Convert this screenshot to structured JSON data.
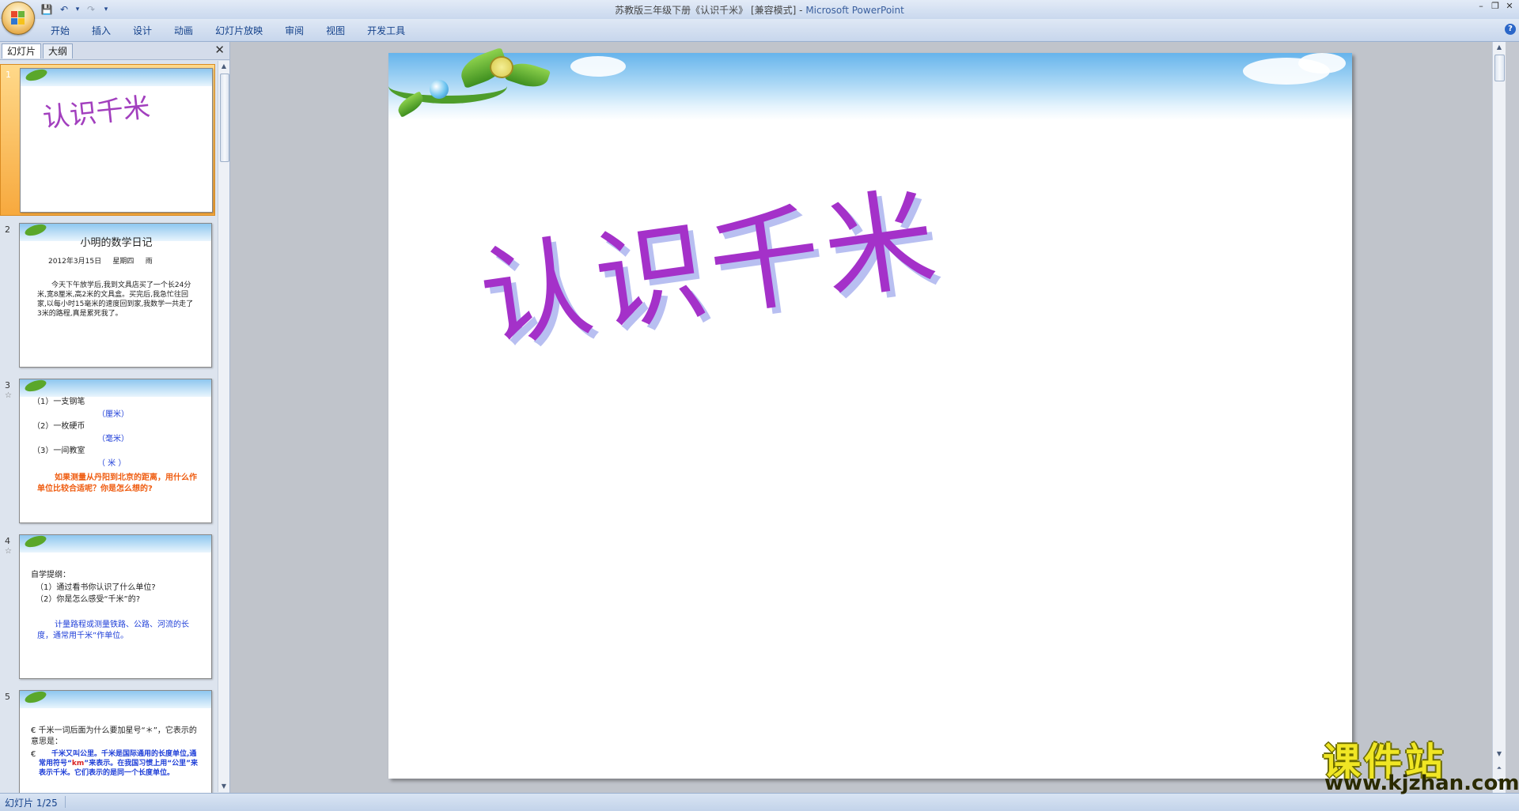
{
  "window": {
    "title": "苏教版三年级下册《认识千米》 [兼容模式] -",
    "app_name": "Microsoft PowerPoint",
    "minimize": "–",
    "restore": "❐",
    "close": "✕"
  },
  "qat": {
    "save": "💾",
    "undo": "↶",
    "undo_arrow": "▾",
    "redo": "↷",
    "customize": "▾"
  },
  "ribbon_tabs": [
    "开始",
    "插入",
    "设计",
    "动画",
    "幻灯片放映",
    "审阅",
    "视图",
    "开发工具"
  ],
  "help": "?",
  "pane_tabs": {
    "slides": "幻灯片",
    "outline": "大纲",
    "close": "✕"
  },
  "thumbnails": [
    {
      "number": "1",
      "title": "认识千米"
    },
    {
      "number": "2",
      "title": "小明的数学日记",
      "date_line": "2012年3月15日     星期四     雨",
      "body": "今天下午放学后,我到文具店买了一个长24分米,宽8厘米,高2米的文具盒。买完后,我急忙往回家,以每小时15毫米的速度回到家,我数学一共走了3米的路程,真是累死我了。"
    },
    {
      "number": "3",
      "star": "☆",
      "lines": [
        "（1）一支钢笔",
        "（厘米）",
        "（2）一枚硬币",
        "（毫米）",
        "（3）一间教室",
        "（ 米 ）"
      ],
      "question": "如果测量从丹阳到北京的距离，用什么作单位比较合适呢？你是怎么想的?"
    },
    {
      "number": "4",
      "star": "☆",
      "heading": "自学提纲：",
      "lines": [
        "（1）通过看书你认识了什么单位?",
        "（2）你是怎么感受“千米”的?"
      ],
      "note": "计量路程或测量铁路、公路、河流的长度，通常用千米”作单位。"
    },
    {
      "number": "5",
      "q": "€ 千米一词后面为什么要加星号“＊”，它表示的意思是：",
      "a_prefix": "€",
      "a_text1": "千米又叫公里。千米是国际通用的长度单位,通常用符号“",
      "a_km": "km",
      "a_text2": "”来表示。在我国习惯上用“公里”来表示千米。它们表示的是同一个长度单位。"
    }
  ],
  "main_slide": {
    "title": "认识千米"
  },
  "status": {
    "slide_counter": "幻灯片 1/25"
  },
  "watermark": {
    "text": "课件站",
    "url": "www.kjzhan.com"
  }
}
